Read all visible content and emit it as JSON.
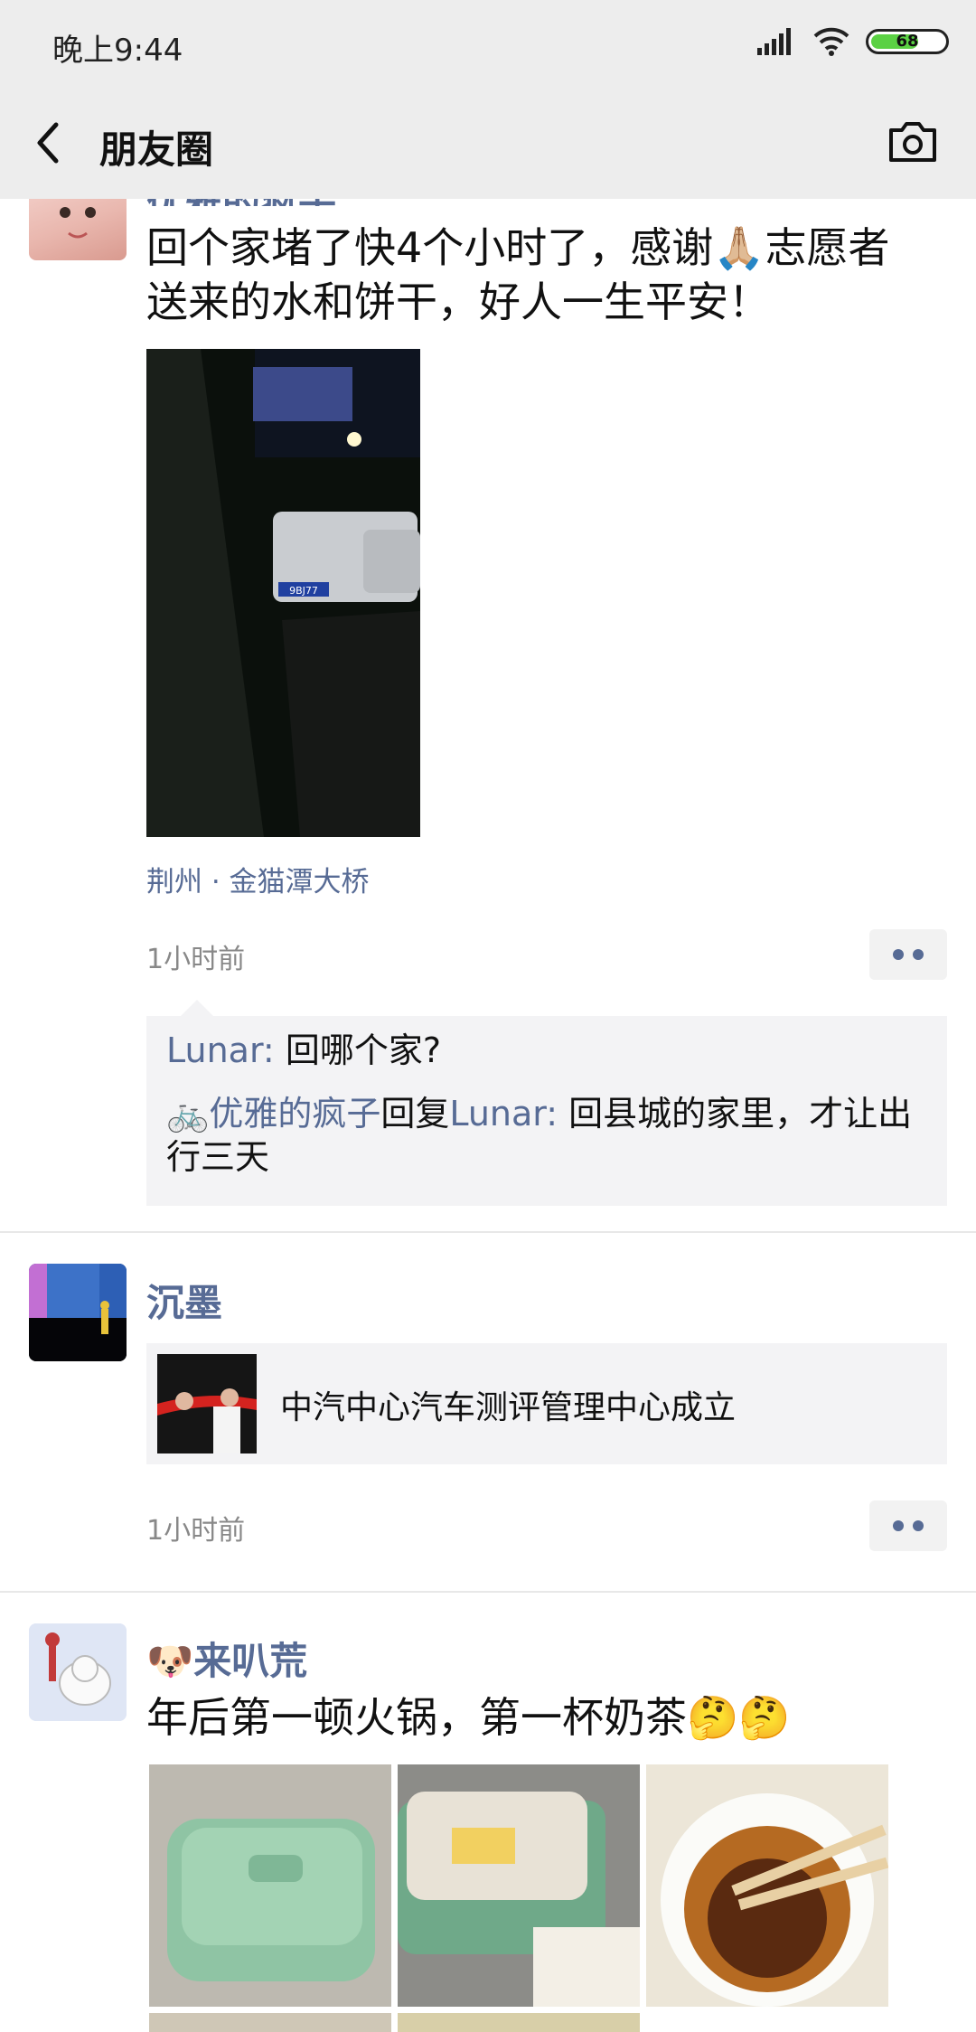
{
  "status": {
    "time": "晚上9:44",
    "battery": "68"
  },
  "nav": {
    "title": "朋友圈"
  },
  "posts": [
    {
      "name_partial": "优雅的疯子",
      "text": "回个家堵了快4个小时了，感谢🙏🏼志愿者送来的水和饼干，好人一生平安！",
      "photo_plate": "9BJ77",
      "location": "荆州 · 金猫潭大桥",
      "time": "1小时前",
      "comments": [
        {
          "author": "Lunar",
          "sep": ": ",
          "text": "回哪个家?"
        },
        {
          "author": "🚲优雅的疯子",
          "reply_word": "回复",
          "reply_to": "Lunar",
          "sep": ": ",
          "text": "回县城的家里，才让出行三天"
        }
      ]
    },
    {
      "name": "沉墨",
      "link_title": "中汽中心汽车测评管理中心成立",
      "time": "1小时前"
    },
    {
      "name": "🐶来叭荒",
      "text": "年后第一顿火锅，第一杯奶茶🤔🤔"
    }
  ],
  "colors": {
    "link": "#576b95",
    "bar_bg": "#ededed",
    "comment_bg": "#f3f3f5"
  }
}
